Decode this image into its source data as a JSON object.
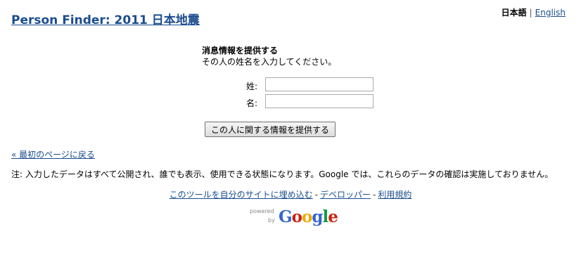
{
  "header": {
    "site_title": "Person Finder: 2011 日本地震",
    "lang_current": "日本語",
    "lang_separator": "|",
    "lang_other": "English"
  },
  "form": {
    "title": "消息情報を提供する",
    "instruction": "その人の姓名を入力してください。",
    "last_name_label": "姓:",
    "last_name_value": "",
    "first_name_label": "名:",
    "first_name_value": "",
    "submit_label": "この人に関する情報を提供する"
  },
  "nav": {
    "back_label": "« 最初のページに戻る"
  },
  "notice": "注: 入力したデータはすべて公開され、誰でも表示、使用できる状態になります。Google では、これらのデータの確認は実施しておりません。",
  "footer": {
    "embed_label": "このツールを自分のサイトに埋め込む",
    "developers_label": "デベロッパー",
    "terms_label": "利用規約",
    "separator": "-"
  },
  "powered_by": {
    "powered_text": "powered",
    "by_text": "by",
    "brand_letters": [
      "G",
      "o",
      "o",
      "g",
      "l",
      "e"
    ],
    "brand_colors": [
      "#3366cc",
      "#cc2211",
      "#eeaa00",
      "#3366cc",
      "#119944",
      "#cc2211"
    ]
  }
}
